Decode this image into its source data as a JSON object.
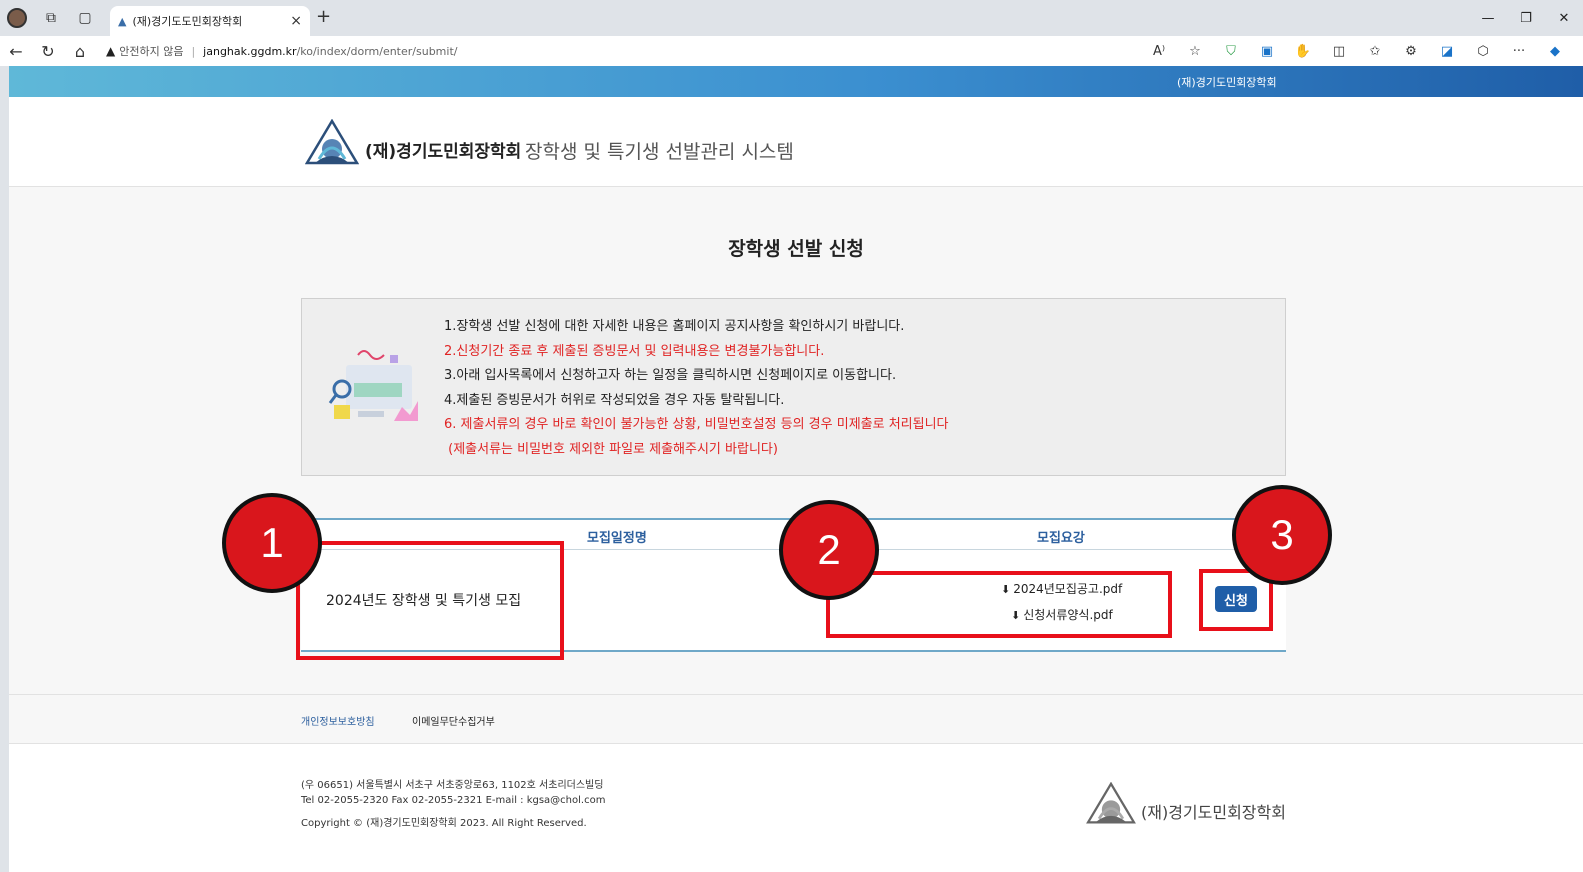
{
  "browser": {
    "tab_title": "(재)경기도도민회장학회",
    "url_warning": "안전하지 않음",
    "url_host": "janghak.ggdm.kr",
    "url_path": "/ko/index/dorm/enter/submit/"
  },
  "site": {
    "top_brand": "(재)경기도민회장학회",
    "org_name": "(재)경기도민회장학회",
    "system_name": "장학생 및 특기생 선발관리 시스템"
  },
  "page_title": "장학생 선발 신청",
  "notices": [
    {
      "text": "1.장학생 선발 신청에 대한 자세한 내용은 홈페이지 공지사항을 확인하시기 바랍니다.",
      "color": "black"
    },
    {
      "text": "2.신청기간 종료 후 제출된 증빙문서 및 입력내용은 변경불가능합니다.",
      "color": "red"
    },
    {
      "text": "3.아래 입사목록에서 신청하고자 하는 일정을 클릭하시면 신청페이지로 이동합니다.",
      "color": "black"
    },
    {
      "text": "4.제출된 증빙문서가 허위로 작성되었을 경우 자동 탈락됩니다.",
      "color": "black"
    },
    {
      "text": "6. 제출서류의 경우 바로 확인이 불가능한 상황, 비밀번호설정 등의 경우 미제출로 처리됩니다",
      "color": "red"
    },
    {
      "text": " (제출서류는 비밀번호 제외한 파일로 제출해주시기 바랍니다)",
      "color": "red"
    }
  ],
  "table": {
    "col_name": "모집일정명",
    "col_guide": "모집요강",
    "row": {
      "name": "2024년도 장학생 및 특기생 모집",
      "file1": "2024년모집공고.pdf",
      "file2": "신청서류양식.pdf",
      "apply_label": "신청"
    }
  },
  "badges": [
    "1",
    "2",
    "3"
  ],
  "footer": {
    "privacy": "개인정보보호방침",
    "email_refuse": "이메일무단수집거부",
    "address": "(우 06651) 서울특별시 서초구 서초중앙로63, 1102호 서초리더스빌딩",
    "contact": "Tel 02-2055-2320 Fax 02-2055-2321 E-mail : kgsa@chol.com",
    "copyright": "Copyright © (재)경기도민회장학회 2023. All Right Reserved.",
    "org_name": "(재)경기도민회장학회"
  },
  "colors": {
    "accent_blue": "#1f5ea8",
    "notice_red": "#e02424",
    "highlight_red": "#e8101a"
  }
}
